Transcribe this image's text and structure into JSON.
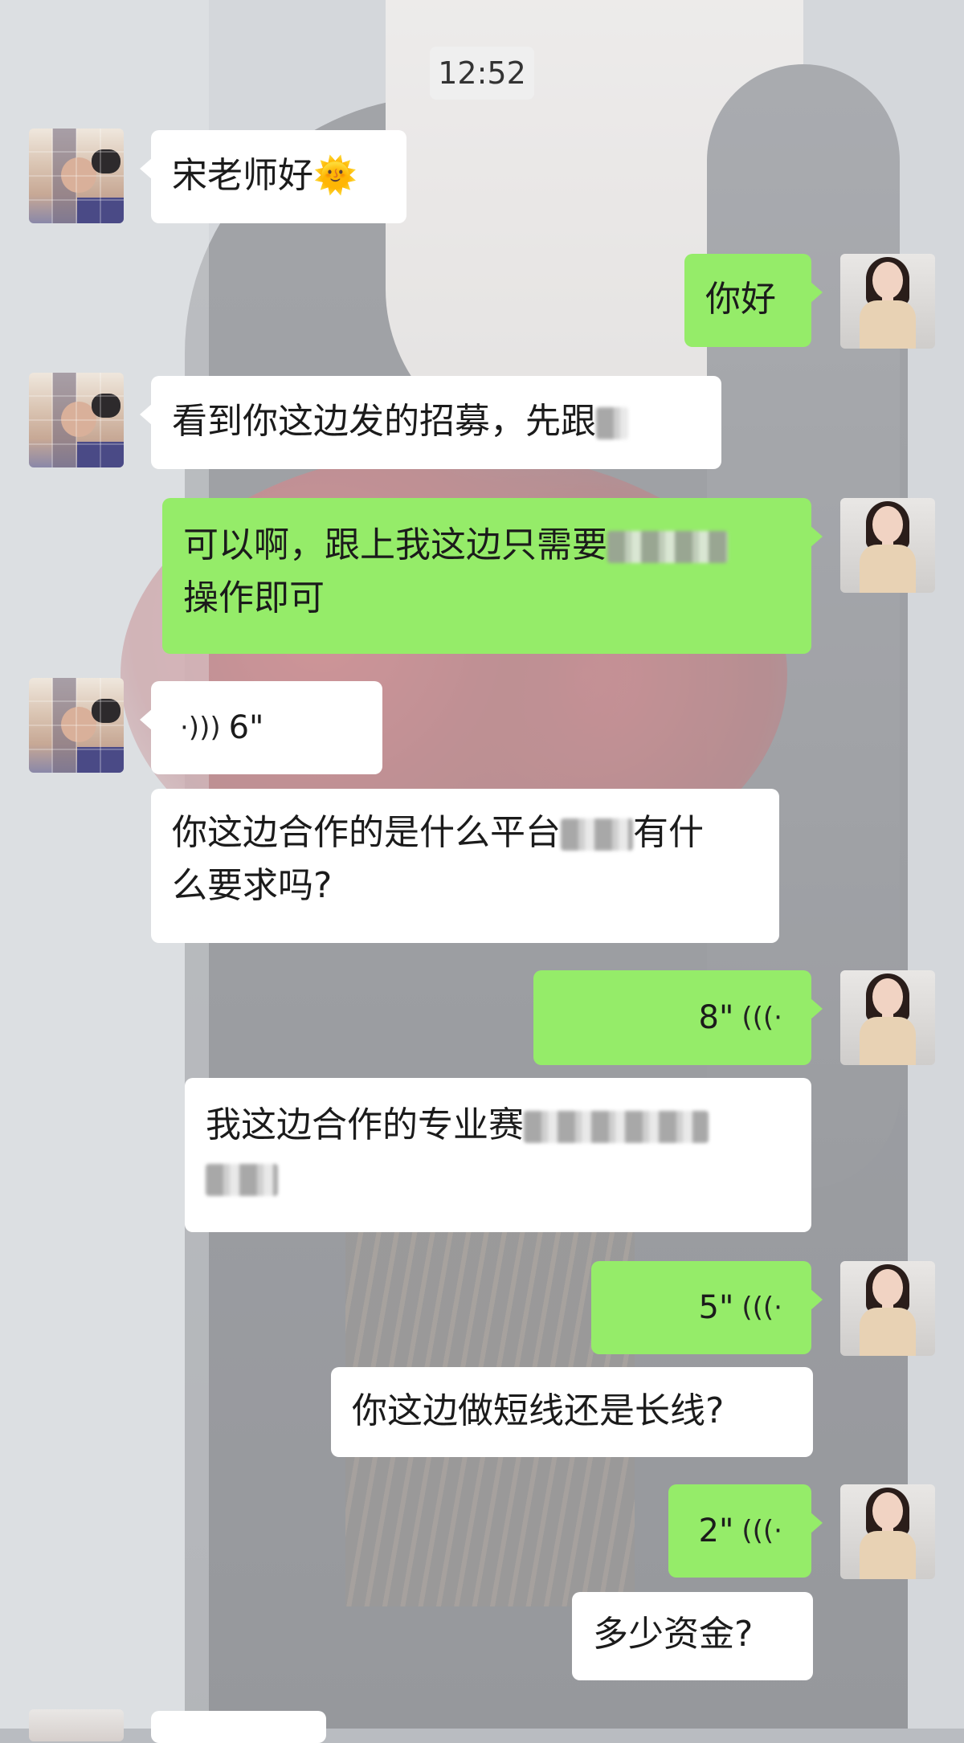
{
  "status": {
    "time": "12:52"
  },
  "messages": [
    {
      "side": "left",
      "text": "宋老师好🌞"
    },
    {
      "side": "right",
      "text": "你好"
    },
    {
      "side": "left",
      "text": "看到你这边发的招募，先跟",
      "blurred": true
    },
    {
      "side": "right",
      "line1": "可以啊，跟上我这边只需要",
      "line2": "操作即可",
      "blurred": true
    },
    {
      "side": "left",
      "voice_duration": "6\""
    },
    {
      "side": "left",
      "line1a": "你这边合作的是什么平台",
      "line1b": "有什",
      "line2": "么要求吗?",
      "blurred": true
    },
    {
      "side": "right",
      "voice_duration": "8\""
    },
    {
      "side": "right",
      "text": "我这边合作的专业赛",
      "blurred": true
    },
    {
      "side": "right",
      "voice_duration": "5\""
    },
    {
      "side": "right",
      "text": "你这边做短线还是长线?"
    },
    {
      "side": "right",
      "voice_duration": "2\""
    },
    {
      "side": "right",
      "text": "多少资金?",
      "blurred": true
    }
  ],
  "icons": {
    "voice_incoming": "voice-wave-right-icon",
    "voice_outgoing": "voice-wave-left-icon"
  },
  "colors": {
    "sent_bubble": "#95ec69",
    "received_bubble": "#ffffff"
  }
}
